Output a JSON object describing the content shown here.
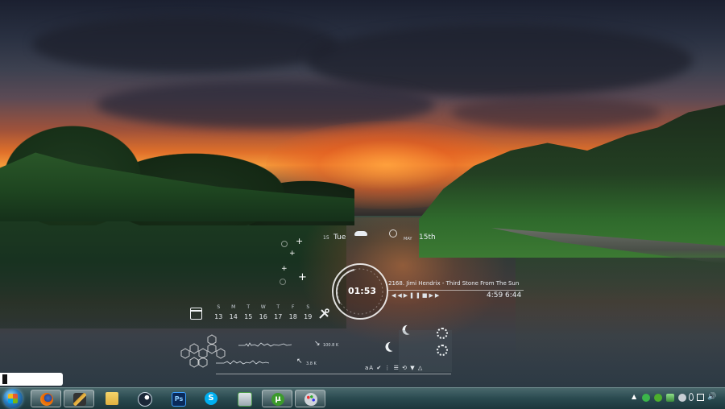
{
  "desktop": {
    "calendar": {
      "day_label": "Tue",
      "month_label": "MAY",
      "date_label": "15th",
      "weekdays": [
        "S",
        "M",
        "T",
        "W",
        "T",
        "F",
        "S"
      ],
      "days": [
        "13",
        "14",
        "15",
        "16",
        "17",
        "18",
        "19"
      ]
    },
    "clock": {
      "time": "01:53"
    },
    "music": {
      "track": "2168. Jimi Hendrix - Third Stone From The Sun",
      "elapsed": "4:59",
      "total": "6:44",
      "controls": [
        "previous-icon",
        "play-icon",
        "pause-icon",
        "stop-icon",
        "next-icon"
      ]
    },
    "network": {
      "download": "100.8 K",
      "upload": "3.8 K"
    },
    "bottom_bar_icons": [
      "font-icon",
      "check-icon",
      "bars-icon",
      "sync-icon",
      "arrow-down-icon",
      "triangle-icon"
    ],
    "bottom_bar_text": "aA"
  },
  "taskbar": {
    "apps": [
      {
        "name": "firefox",
        "color": "#e66000",
        "active": true
      },
      {
        "name": "winamp",
        "color": "#d8a030",
        "active": true
      },
      {
        "name": "explorer",
        "color": "#e8c25a",
        "active": false
      },
      {
        "name": "steam",
        "color": "#1b2838",
        "active": false
      },
      {
        "name": "photoshop",
        "color": "#0a2a5a",
        "label": "Ps",
        "active": false
      },
      {
        "name": "skype",
        "color": "#00aff0",
        "active": false
      },
      {
        "name": "remote-desktop",
        "color": "#4a9a4a",
        "active": false
      },
      {
        "name": "utorrent",
        "color": "#3c9a2c",
        "active": true
      },
      {
        "name": "paint",
        "color": "#d0d4da",
        "active": true
      }
    ],
    "tray_icons": [
      "show-hidden-icon",
      "whatsapp-icon",
      "utorrent-tray-icon",
      "network-tray-icon",
      "disk-icon",
      "droplet-icon",
      "monitor-icon",
      "volume-icon"
    ]
  }
}
